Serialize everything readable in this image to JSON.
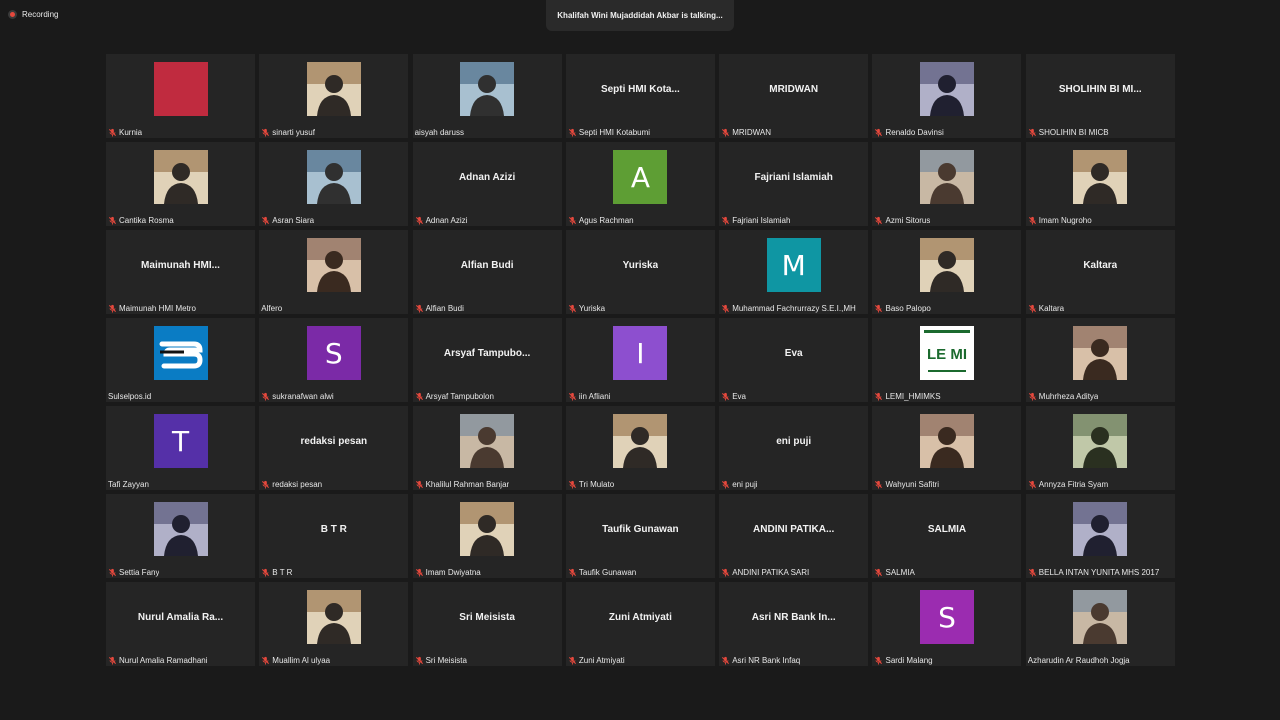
{
  "recording": {
    "label": "Recording"
  },
  "banner": {
    "text": "Khalifah Wini Mujaddidah Akbar  is talking..."
  },
  "colors": {
    "background": "#1a1a1a",
    "tile": "#252525",
    "muted_mic": "#e5483d"
  },
  "participants": [
    {
      "label": "Kurnia",
      "display": "",
      "avatar": "color",
      "color": "#c02b3f",
      "muted": true
    },
    {
      "label": "sinarti yusuf",
      "display": "",
      "avatar": "photo",
      "muted": true
    },
    {
      "label": "aisyah daruss",
      "display": "",
      "avatar": "photo",
      "muted": false
    },
    {
      "label": "Septi HMI Kotabumi",
      "display": "Septi  HMI  Kota...",
      "avatar": "none",
      "muted": true
    },
    {
      "label": "MRIDWAN",
      "display": "MRIDWAN",
      "avatar": "none",
      "muted": true
    },
    {
      "label": "Renaldo Davinsi",
      "display": "",
      "avatar": "photo",
      "muted": true
    },
    {
      "label": "SHOLIHIN BI MICB",
      "display": "SHOLIHIN  BI  MI...",
      "avatar": "none",
      "muted": true
    },
    {
      "label": "Cantika Rosma",
      "display": "",
      "avatar": "photo",
      "muted": true
    },
    {
      "label": "Asran Siara",
      "display": "",
      "avatar": "photo",
      "muted": true
    },
    {
      "label": "Adnan Azizi",
      "display": "Adnan Azizi",
      "avatar": "none",
      "muted": true
    },
    {
      "label": "Agus Rachman",
      "display": "",
      "avatar": "letter",
      "letter": "A",
      "color": "#5e9e34",
      "muted": true
    },
    {
      "label": "Fajriani Islamiah",
      "display": "Fajriani Islamiah",
      "avatar": "none",
      "muted": true
    },
    {
      "label": "Azmi Sitorus",
      "display": "",
      "avatar": "photo",
      "muted": true
    },
    {
      "label": "Imam Nugroho",
      "display": "",
      "avatar": "photo",
      "muted": true
    },
    {
      "label": "Maimunah HMI Metro",
      "display": "Maimunah  HMI...",
      "avatar": "none",
      "muted": true
    },
    {
      "label": "Alfero",
      "display": "",
      "avatar": "photo",
      "muted": false
    },
    {
      "label": "Alfian Budi",
      "display": "Alfian Budi",
      "avatar": "none",
      "muted": true
    },
    {
      "label": "Yuriska",
      "display": "Yuriska",
      "avatar": "none",
      "muted": true
    },
    {
      "label": "Muhammad Fachrurrazy S.E.I.,MH",
      "display": "",
      "avatar": "letter",
      "letter": "M",
      "color": "#0f96a3",
      "muted": true
    },
    {
      "label": "Baso Palopo",
      "display": "",
      "avatar": "photo",
      "muted": true
    },
    {
      "label": "Kaltara",
      "display": "Kaltara",
      "avatar": "none",
      "muted": true
    },
    {
      "label": "Sulselpos.id",
      "display": "",
      "avatar": "logo-sp",
      "muted": false
    },
    {
      "label": "sukranafwan alwi",
      "display": "",
      "avatar": "letter",
      "letter": "S",
      "color": "#7b2aa7",
      "muted": true
    },
    {
      "label": "Arsyaf Tampubolon",
      "display": "Arsyaf  Tampubo...",
      "avatar": "none",
      "muted": true
    },
    {
      "label": "iin Afliani",
      "display": "",
      "avatar": "letter",
      "letter": "I",
      "color": "#8d4fcf",
      "muted": true
    },
    {
      "label": "Eva",
      "display": "Eva",
      "avatar": "none",
      "muted": true
    },
    {
      "label": "LEMI_HMIMKS",
      "display": "",
      "avatar": "logo-lemi",
      "logo_text": "LE MI",
      "muted": true
    },
    {
      "label": "Muhrheza Aditya",
      "display": "",
      "avatar": "photo",
      "muted": true
    },
    {
      "label": "Tafi Zayyan",
      "display": "",
      "avatar": "letter",
      "letter": "T",
      "color": "#5530a8",
      "muted": false
    },
    {
      "label": "redaksi pesan",
      "display": "redaksi pesan",
      "avatar": "none",
      "muted": true
    },
    {
      "label": "Khalilul Rahman Banjar",
      "display": "",
      "avatar": "photo",
      "muted": true
    },
    {
      "label": "Tri Mulato",
      "display": "",
      "avatar": "photo",
      "muted": true
    },
    {
      "label": "eni puji",
      "display": "eni puji",
      "avatar": "none",
      "muted": true
    },
    {
      "label": "Wahyuni Safitri",
      "display": "",
      "avatar": "photo",
      "muted": true
    },
    {
      "label": "Annyza Fitria Syam",
      "display": "",
      "avatar": "photo",
      "muted": true
    },
    {
      "label": "Settia Fany",
      "display": "",
      "avatar": "photo",
      "muted": true
    },
    {
      "label": "B T R",
      "display": "B  T  R",
      "avatar": "none",
      "muted": true
    },
    {
      "label": "Imam Dwiyatna",
      "display": "",
      "avatar": "photo",
      "muted": true
    },
    {
      "label": "Taufik Gunawan",
      "display": "Taufik Gunawan",
      "avatar": "none",
      "muted": true
    },
    {
      "label": "ANDINI PATIKA SARI",
      "display": "ANDINI  PATIKA...",
      "avatar": "none",
      "muted": true
    },
    {
      "label": "SALMIA",
      "display": "SALMIA",
      "avatar": "none",
      "muted": true
    },
    {
      "label": "BELLA INTAN YUNITA MHS 2017",
      "display": "",
      "avatar": "photo",
      "muted": true
    },
    {
      "label": "Nurul Amalia Ramadhani",
      "display": "Nurul  Amalia  Ra...",
      "avatar": "none",
      "muted": true
    },
    {
      "label": "Muallim Al ulyaa",
      "display": "",
      "avatar": "photo",
      "muted": true
    },
    {
      "label": "Sri Meisista",
      "display": "Sri Meisista",
      "avatar": "none",
      "muted": true
    },
    {
      "label": "Zuni Atmiyati",
      "display": "Zuni Atmiyati",
      "avatar": "none",
      "muted": true
    },
    {
      "label": "Asri NR Bank Infaq",
      "display": "Asri  NR  Bank  In...",
      "avatar": "none",
      "muted": true
    },
    {
      "label": "Sardi Malang",
      "display": "",
      "avatar": "letter",
      "letter": "S",
      "color": "#9b2cb0",
      "muted": true
    },
    {
      "label": "Azharudin Ar Raudhoh Jogja",
      "display": "",
      "avatar": "photo",
      "muted": false
    }
  ]
}
